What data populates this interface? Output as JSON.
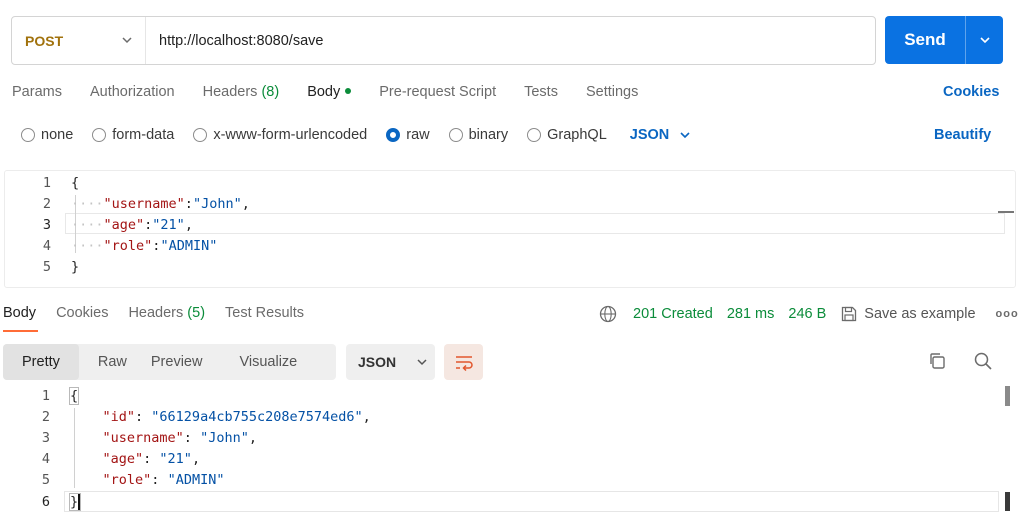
{
  "request": {
    "method": "POST",
    "url": "http://localhost:8080/save",
    "send_label": "Send"
  },
  "request_tabs": [
    {
      "label": "Params"
    },
    {
      "label": "Authorization"
    },
    {
      "label": "Headers",
      "count": "(8)"
    },
    {
      "label": "Body",
      "active": true
    },
    {
      "label": "Pre-request Script"
    },
    {
      "label": "Tests"
    },
    {
      "label": "Settings"
    }
  ],
  "cookies_label": "Cookies",
  "body_types": [
    "none",
    "form-data",
    "x-www-form-urlencoded",
    "raw",
    "binary",
    "GraphQL"
  ],
  "body_type_selected": "raw",
  "body_format": "JSON",
  "beautify_label": "Beautify",
  "request_body_lines": [
    {
      "n": "1",
      "text": "{"
    },
    {
      "n": "2",
      "key": "\"username\"",
      "sep": ":",
      "val": "\"John\"",
      "end": ","
    },
    {
      "n": "3",
      "key": "\"age\"",
      "sep": ":",
      "val": "\"21\"",
      "end": ","
    },
    {
      "n": "4",
      "key": "\"role\"",
      "sep": ":",
      "val": "\"ADMIN\"",
      "end": ""
    },
    {
      "n": "5",
      "text": "}"
    }
  ],
  "response_tabs": [
    {
      "label": "Body",
      "active": true
    },
    {
      "label": "Cookies"
    },
    {
      "label": "Headers",
      "count": "(5)"
    },
    {
      "label": "Test Results"
    }
  ],
  "response_meta": {
    "status": "201 Created",
    "time": "281 ms",
    "size": "246 B",
    "save_label": "Save as example",
    "more": "ooo"
  },
  "view_modes": [
    "Pretty",
    "Raw",
    "Preview",
    "Visualize"
  ],
  "view_mode_selected": "Pretty",
  "response_format": "JSON",
  "response_body_lines": [
    {
      "n": "1",
      "text": "{"
    },
    {
      "n": "2",
      "key": "\"id\"",
      "sep": ": ",
      "val": "\"66129a4cb755c208e7574ed6\"",
      "end": ","
    },
    {
      "n": "3",
      "key": "\"username\"",
      "sep": ": ",
      "val": "\"John\"",
      "end": ","
    },
    {
      "n": "4",
      "key": "\"age\"",
      "sep": ": ",
      "val": "\"21\"",
      "end": ","
    },
    {
      "n": "5",
      "key": "\"role\"",
      "sep": ": ",
      "val": "\"ADMIN\"",
      "end": ""
    },
    {
      "n": "6",
      "text": "}"
    }
  ],
  "colors": {
    "send_blue": "#0a72e2",
    "method_orange": "#a1720d",
    "status_green": "#0b8c3a",
    "link_blue": "#0a66c2",
    "active_underline": "#ff6c37"
  }
}
